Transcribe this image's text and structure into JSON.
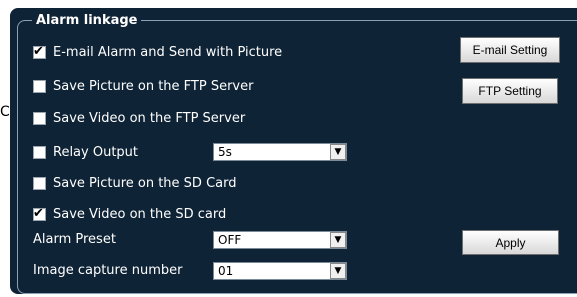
{
  "group": {
    "legend": "Alarm linkage"
  },
  "stray_text": "C",
  "options": [
    {
      "label": "E-mail Alarm and Send with Picture",
      "checked": true
    },
    {
      "label": "Save Picture on the FTP Server",
      "checked": false
    },
    {
      "label": "Save Video on the FTP Server",
      "checked": false
    },
    {
      "label": "Relay Output",
      "checked": false
    },
    {
      "label": "Save Picture on the SD Card",
      "checked": false
    },
    {
      "label": "Save Video on the SD card",
      "checked": true
    }
  ],
  "relay_select": {
    "value": "5s"
  },
  "alarm_preset": {
    "label": "Alarm Preset",
    "value": "OFF"
  },
  "image_capture": {
    "label": "Image capture number",
    "value": "01"
  },
  "buttons": {
    "email_setting": "E-mail Setting",
    "ftp_setting": "FTP Setting",
    "apply": "Apply"
  },
  "check_glyph": "✔",
  "arrow_glyph": "▼"
}
